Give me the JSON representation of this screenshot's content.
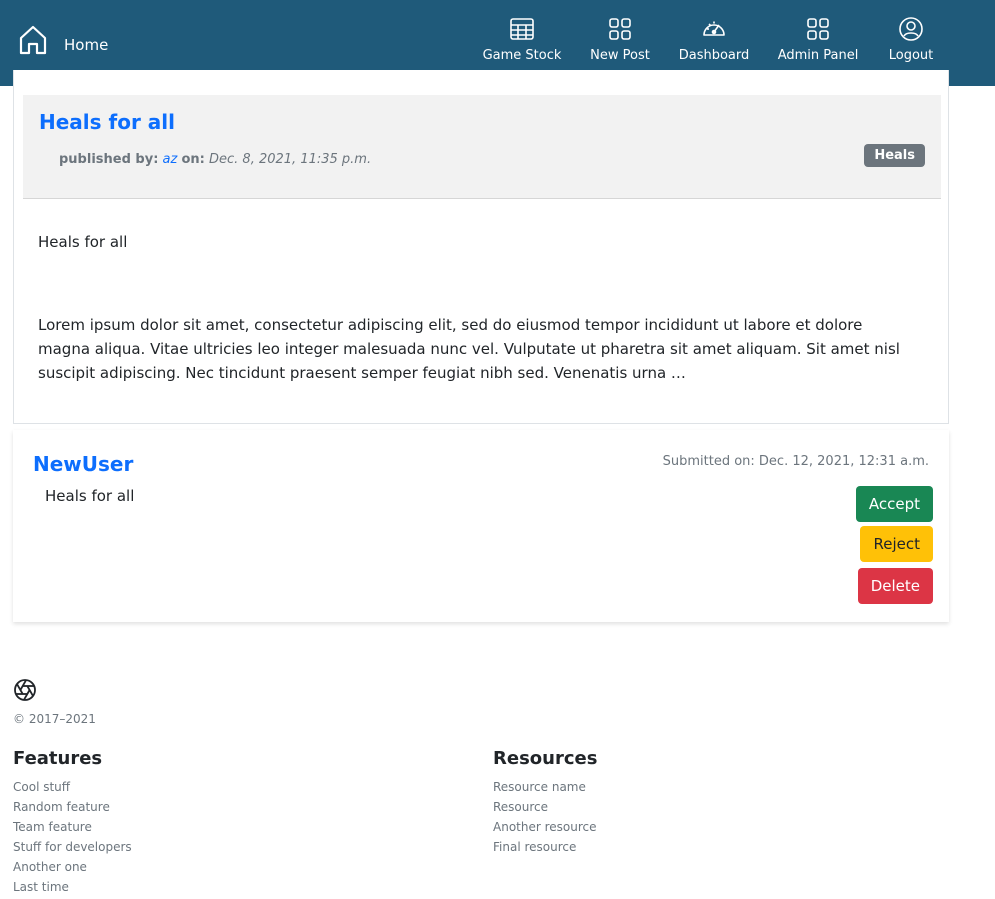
{
  "nav": {
    "home_label": "Home",
    "items": [
      {
        "label": "Game Stock",
        "icon": "table-icon"
      },
      {
        "label": "New Post",
        "icon": "grid-icon"
      },
      {
        "label": "Dashboard",
        "icon": "speedometer-icon"
      },
      {
        "label": "Admin Panel",
        "icon": "grid-icon"
      },
      {
        "label": "Logout",
        "icon": "user-circle-icon"
      }
    ],
    "background_color": "#1f5a7a"
  },
  "post": {
    "title": "Heals for all",
    "published_by_label": "published by:",
    "author": "az",
    "on_label": "on:",
    "date": "Dec. 8, 2021, 11:35 p.m.",
    "tag": "Heals",
    "summary": "Heals for all",
    "body": "Lorem ipsum dolor sit amet, consectetur adipiscing elit, sed do eiusmod tempor incididunt ut labore et dolore magna aliqua. Vitae ultricies leo integer malesuada nunc vel. Vulputate ut pharetra sit amet aliquam. Sit amet nisl suscipit adipiscing. Nec tincidunt praesent semper feugiat nibh sed. Venenatis urna …"
  },
  "submission": {
    "user": "NewUser",
    "submitted": "Submitted on: Dec. 12, 2021, 12:31 a.m.",
    "post_title": "Heals for all",
    "accept_label": "Accept",
    "reject_label": "Reject",
    "delete_label": "Delete"
  },
  "footer": {
    "copyright": "© 2017–2021",
    "features": {
      "heading": "Features",
      "links": [
        "Cool stuff",
        "Random feature",
        "Team feature",
        "Stuff for developers",
        "Another one",
        "Last time"
      ]
    },
    "resources": {
      "heading": "Resources",
      "links": [
        "Resource name",
        "Resource",
        "Another resource",
        "Final resource"
      ]
    }
  },
  "colors": {
    "link": "#0d6efd",
    "accept": "#198754",
    "reject": "#ffc107",
    "delete": "#dc3545",
    "badge": "#6c757d"
  }
}
